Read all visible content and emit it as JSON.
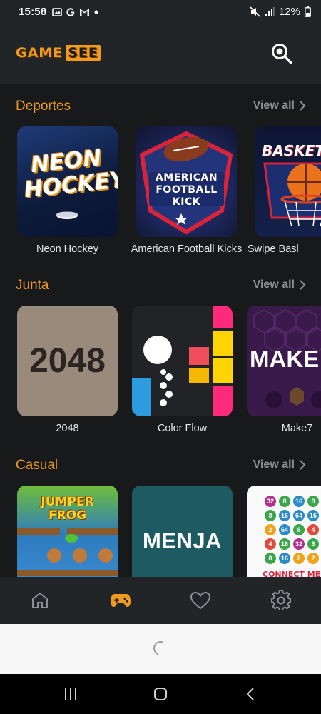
{
  "status_bar": {
    "time": "15:58",
    "battery": "12%",
    "icons": [
      "photo-icon",
      "google-icon",
      "gmail-icon",
      "dot-icon",
      "mute-icon",
      "signal-icon",
      "battery-icon"
    ]
  },
  "header": {
    "logo_text_1": "GAME",
    "logo_text_2": "SEE",
    "search_icon": "search-icon"
  },
  "sections": [
    {
      "title": "Deportes",
      "view_all": "View all",
      "games": [
        {
          "name": "Neon Hockey",
          "art_text": "NEON HOCKEY"
        },
        {
          "name": "American Football Kicks",
          "art_text": "AMERICAN FOOTBALL KICK"
        },
        {
          "name": "Swipe Basl",
          "art_text": "BASKET"
        }
      ]
    },
    {
      "title": "Junta",
      "view_all": "View all",
      "games": [
        {
          "name": "2048",
          "art_text": "2048"
        },
        {
          "name": "Color Flow",
          "art_text": ""
        },
        {
          "name": "Make7",
          "art_text": "MAKE"
        }
      ]
    },
    {
      "title": "Casual",
      "view_all": "View all",
      "games": [
        {
          "name": "",
          "art_text": "JUMPER FROG"
        },
        {
          "name": "",
          "art_text": "MENJA"
        },
        {
          "name": "",
          "art_text": "CONNECT ME"
        }
      ]
    }
  ],
  "bottom_nav": [
    {
      "icon": "home-icon",
      "active": false
    },
    {
      "icon": "gamepad-icon",
      "active": true
    },
    {
      "icon": "heart-icon",
      "active": false
    },
    {
      "icon": "settings-icon",
      "active": false
    }
  ],
  "colors": {
    "accent": "#F19A1E",
    "background": "#17191b",
    "header": "#222528",
    "muted": "#8d9196"
  }
}
